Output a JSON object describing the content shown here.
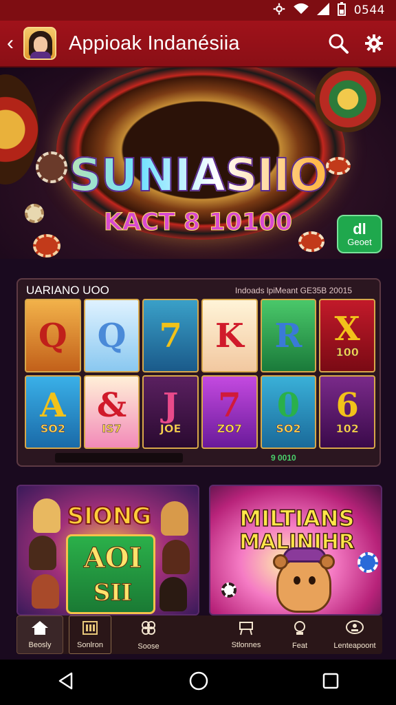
{
  "status_bar": {
    "time": "0544",
    "icons": [
      "settings-icon",
      "wifi-icon",
      "signal-icon",
      "battery-icon"
    ]
  },
  "app_bar": {
    "title": "Appioak Indanésiia",
    "back_icon": "chevron-left-icon",
    "search_icon": "search-icon",
    "settings_icon": "gear-icon"
  },
  "hero": {
    "title": "SUNIASIIO",
    "subtitle": "KACT 8 10100",
    "cta_top": "dl",
    "cta_bottom": "Geoet"
  },
  "slot": {
    "heading": "UARIANO UOO",
    "heading_right": "Indoads lpiMeant  GE35B 20015",
    "score": "9 0010",
    "reels": [
      {
        "symbol": "Q",
        "caption": "",
        "symbol_color": "#c0201a",
        "bg": "linear-gradient(#f2b24a,#c2601a)"
      },
      {
        "symbol": "Q",
        "caption": "",
        "symbol_color": "#4a8ad8",
        "bg": "linear-gradient(#dff2ff,#8ac8f0)"
      },
      {
        "symbol": "7",
        "caption": "",
        "symbol_color": "#f2c21a",
        "bg": "linear-gradient(#3aa0c8,#1a5a8a)"
      },
      {
        "symbol": "K",
        "caption": "",
        "symbol_color": "#d01a2a",
        "bg": "linear-gradient(#fff4d8,#f2c8a0)"
      },
      {
        "symbol": "R",
        "caption": "",
        "symbol_color": "#3a7ad8",
        "bg": "linear-gradient(#4ac86a,#1a7a3a)"
      },
      {
        "symbol": "X",
        "caption": "100",
        "symbol_color": "#f2c21a",
        "bg": "linear-gradient(#c21a2a,#7a0a14)"
      },
      {
        "symbol": "A",
        "caption": "SO2",
        "symbol_color": "#f2c21a",
        "bg": "linear-gradient(#3ab0e8,#1a6aa8)"
      },
      {
        "symbol": "&",
        "caption": "IS7",
        "symbol_color": "#d01a2a",
        "bg": "linear-gradient(#fff0d8,#f28ab8)"
      },
      {
        "symbol": "J",
        "caption": "JOE",
        "symbol_color": "#e84a8a",
        "bg": "linear-gradient(#5a2060,#2a0a30)"
      },
      {
        "symbol": "7",
        "caption": "ZO7",
        "symbol_color": "#d01a3a",
        "bg": "linear-gradient(#c44ae0,#6a1a9a)"
      },
      {
        "symbol": "0",
        "caption": "SO2",
        "symbol_color": "#2ab04a",
        "bg": "linear-gradient(#3ab0d8,#1a6a9a)"
      },
      {
        "symbol": "6",
        "caption": "102",
        "symbol_color": "#f2c21a",
        "bg": "linear-gradient(#7a2a8a,#3a0a4a)"
      }
    ]
  },
  "cards": {
    "left": {
      "title": "SIONG",
      "board_top": "AOI",
      "board_bottom": "SII"
    },
    "right": {
      "title_line1": "MILTIANS",
      "title_line2": "MALINIHR"
    }
  },
  "tabs": [
    {
      "label": "Beosly",
      "icon": "home-icon",
      "active": true
    },
    {
      "label": "Sonlron",
      "icon": "slot-machine-icon",
      "active": false,
      "boxed": true
    },
    {
      "label": "Soose",
      "icon": "clover-icon",
      "active": false
    },
    {
      "label": "Stlonnes",
      "icon": "table-icon",
      "active": false
    },
    {
      "label": "Feat",
      "icon": "trophy-icon",
      "active": false
    },
    {
      "label": "Lenteapoont",
      "icon": "dealer-icon",
      "active": false
    }
  ],
  "nav": {
    "back": "back-icon",
    "home": "home-circle-icon",
    "recents": "recents-icon"
  }
}
